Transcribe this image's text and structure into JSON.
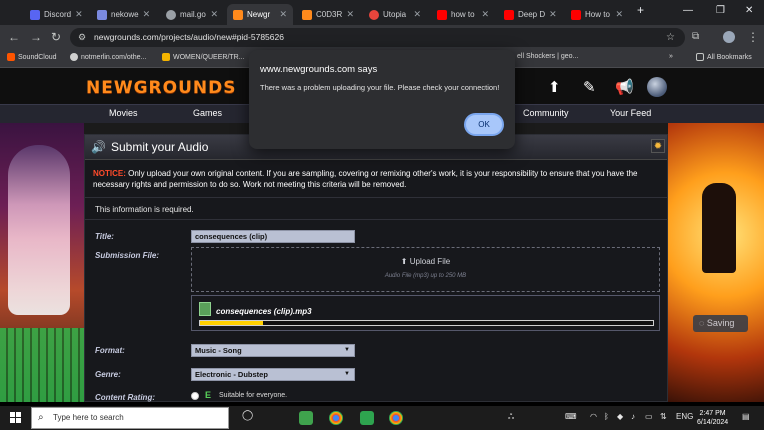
{
  "browser": {
    "tabs": [
      {
        "label": "Discord",
        "color": "#5865f2"
      },
      {
        "label": "nekowe",
        "color": "#7b8ae0"
      },
      {
        "label": "mail.go",
        "color": "#9aa0a6"
      },
      {
        "label": "Newgr",
        "color": "#ff8a1c",
        "active": true
      },
      {
        "label": "C0D3R",
        "color": "#ff8a1c"
      },
      {
        "label": "Utopia",
        "color": "#e8453c"
      },
      {
        "label": "how to",
        "color": "#ff0000"
      },
      {
        "label": "Deep D",
        "color": "#ff0000"
      },
      {
        "label": "How to",
        "color": "#ff0000"
      }
    ],
    "new_tab": "+",
    "window_controls": {
      "minimize": "—",
      "maximize": "❐",
      "close": "✕"
    },
    "url": "newgrounds.com/projects/audio/new#pid-5785626",
    "bookmarks": [
      {
        "label": "SoundCloud",
        "color": "#ff5500"
      },
      {
        "label": "notmerlin.com/othe...",
        "color": "#cfcfcf"
      },
      {
        "label": "WOMEN/QUEER/TR...",
        "color": "#f4b400"
      },
      {
        "label": "ell Shockers | geo...",
        "color": "#9aa0a6"
      },
      {
        "label": "All Bookmarks",
        "color": "#c4c7c5"
      }
    ],
    "bookmarks_more": "»"
  },
  "site": {
    "logo": "NEWGROUNDS",
    "nav": [
      "Movies",
      "Games",
      "Community",
      "Your Feed"
    ]
  },
  "form": {
    "header_title": "Submit your Audio",
    "notice_label": "NOTICE:",
    "notice_text": "Only upload your own original content. If you are sampling, covering or remixing other's work, it is your responsibility to ensure that you have the necessary rights and permission to do so. Work not meeting this criteria will be removed.",
    "required_note": "This information is required.",
    "title_label": "Title:",
    "title_value": "consequences (clip)",
    "file_label": "Submission File:",
    "upload_button": "Upload File",
    "upload_hint": "Audio File (mp3) up to 250 MB",
    "uploaded_file": "consequences (clip).mp3",
    "upload_progress": 0.14,
    "format_label": "Format:",
    "format_value": "Music - Song",
    "genre_label": "Genre:",
    "genre_value": "Electronic - Dubstep",
    "rating_label": "Content Rating:",
    "rating_letter": "E",
    "rating_text": "Suitable for everyone.",
    "saving": "Saving"
  },
  "dialog": {
    "title": "www.newgrounds.com says",
    "message": "There was a problem uploading your file. Please check your connection!",
    "ok": "OK"
  },
  "taskbar": {
    "search_placeholder": "Type here to search",
    "lang": "ENG",
    "time": "2:47 PM",
    "date": "6/14/2024"
  }
}
